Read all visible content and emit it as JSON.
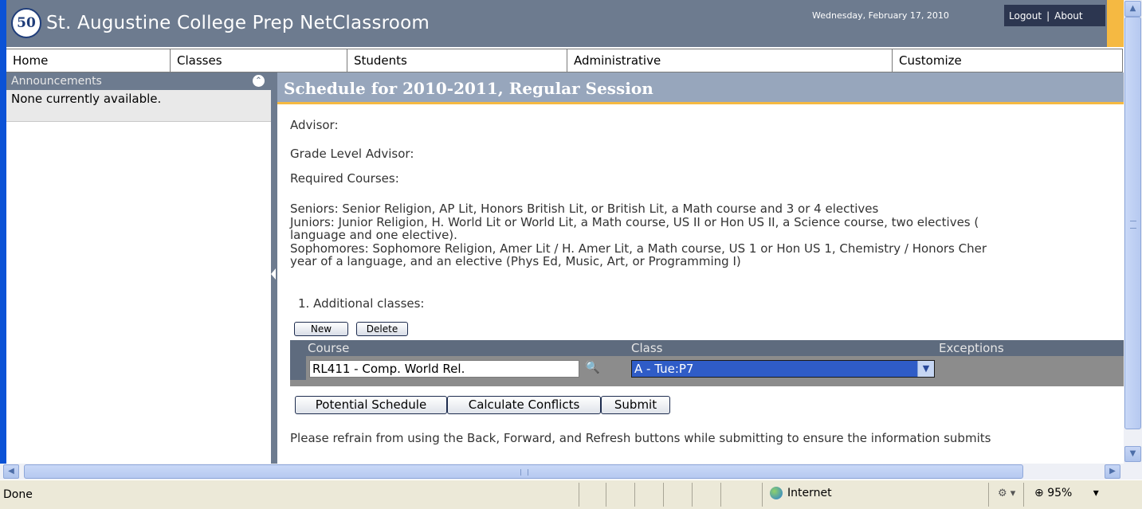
{
  "header": {
    "logo_text": "50",
    "title": "St. Augustine College Prep NetClassroom",
    "date": "Wednesday, February 17, 2010",
    "logout_label": "Logout",
    "separator": "|",
    "about_label": "About"
  },
  "menu": {
    "items": [
      {
        "label": "Home"
      },
      {
        "label": "Classes"
      },
      {
        "label": "Students"
      },
      {
        "label": "Administrative"
      },
      {
        "label": "Customize"
      }
    ]
  },
  "sidebar": {
    "announcements_title": "Announcements",
    "collapse_glyph": "⌃",
    "announcements_body": "None currently available."
  },
  "main": {
    "title": "Schedule for 2010-2011, Regular Session",
    "advisor_label": "Advisor:",
    "grade_level_advisor_label": "Grade Level Advisor:",
    "required_courses_label": "Required Courses:",
    "requirements": [
      "Seniors: Senior Religion, AP Lit, Honors British Lit, or British Lit, a Math course and 3 or 4 electives",
      "Juniors: Junior Religion, H. World Lit or World Lit, a Math course, US II or Hon US II, a Science course, two electives (",
      "language and one elective).",
      "Sophomores: Sophomore Religion, Amer Lit / H. Amer Lit, a Math course, US 1 or Hon US 1, Chemistry / Honors Cher",
      "year of a language, and an elective (Phys Ed, Music, Art, or Programming I)"
    ],
    "additional_classes_label": "1. Additional classes:",
    "new_button": "New",
    "delete_button": "Delete",
    "grid": {
      "columns": [
        "Course",
        "Class",
        "Exceptions"
      ],
      "rows": [
        {
          "course": "RL411 - Comp. World Rel.",
          "class": "A - Tue:P7",
          "exceptions": ""
        }
      ]
    },
    "potential_schedule_button": "Potential Schedule",
    "calculate_conflicts_button": "Calculate Conflicts",
    "submit_button": "Submit",
    "note": "Please refrain from using the Back, Forward, and Refresh buttons while submitting to ensure the information submits"
  },
  "statusbar": {
    "status": "Done",
    "zone": "Internet",
    "zoom": "95%"
  },
  "colors": {
    "header_bg": "#6d7b8f",
    "title_bar_bg": "#97a6bc",
    "accent": "#f5b942",
    "selected_class_bg": "#2f5cc7"
  }
}
